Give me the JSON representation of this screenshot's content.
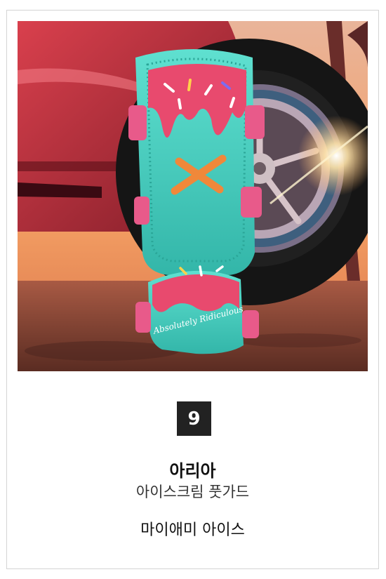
{
  "product": {
    "rank": "9",
    "brand": "아리아",
    "name": "아이스크림 풋가드",
    "colorway": "마이애미 아이스",
    "image_text": "Absolutely Ridiculous"
  },
  "colors": {
    "mint": "#49d3c4",
    "pink": "#e84a6e",
    "orange": "#f0883a",
    "rank_bg": "#222222"
  }
}
